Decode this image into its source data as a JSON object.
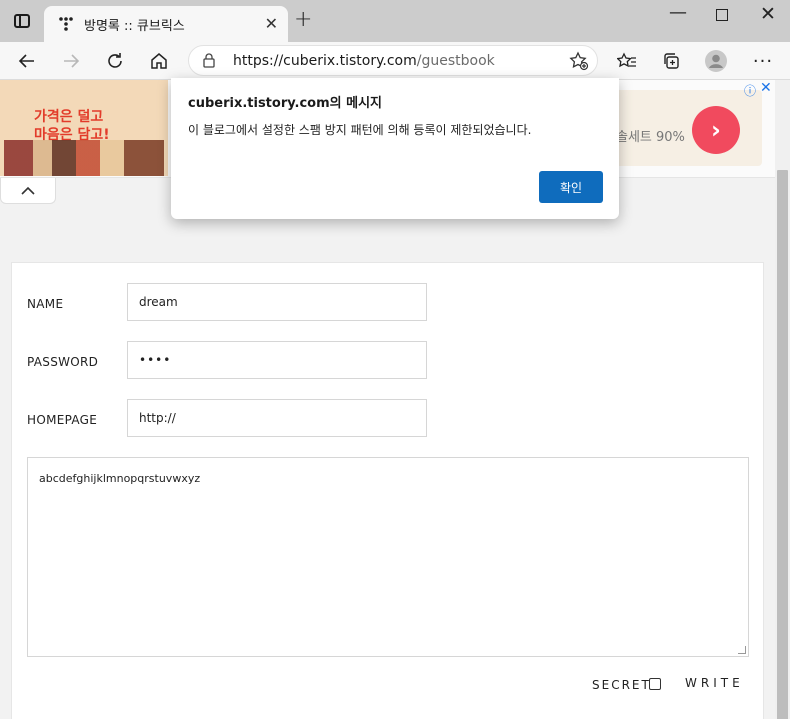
{
  "browser": {
    "tab_title": "방명록 :: 큐브릭스",
    "tab_close": "✕",
    "new_tab": "+",
    "url_host": "https://cuberix.tistory.com",
    "url_path": "/guestbook"
  },
  "ad": {
    "left_line1": "가격은 덜고",
    "left_line2": "마음은 담고!",
    "right_text": "솔세트 90%",
    "go": "›",
    "info": "ⓘ",
    "close": "✕"
  },
  "form": {
    "name_label": "NAME",
    "name_value": "dream",
    "password_label": "PASSWORD",
    "password_value": "••••",
    "homepage_label": "HOMEPAGE",
    "homepage_value": "http://",
    "content": "abcdefghijklmnopqrstuvwxyz",
    "secret_label": "SECRET",
    "write_label": "WRITE"
  },
  "dialog": {
    "title": "cuberix.tistory.com의 메시지",
    "message": "이 블로그에서 설정한 스팸 방지 패턴에 의해 등록이 제한되었습니다.",
    "ok_label": "확인"
  }
}
